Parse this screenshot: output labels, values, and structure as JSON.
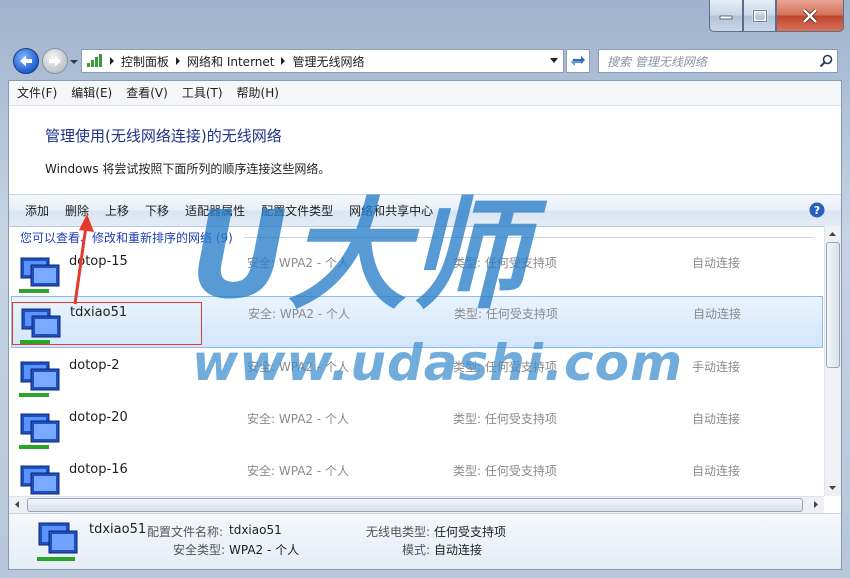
{
  "address": {
    "crumbs": [
      "控制面板",
      "网络和 Internet",
      "管理无线网络"
    ]
  },
  "search": {
    "placeholder": "搜索 管理无线网络"
  },
  "menu": [
    "文件(F)",
    "编辑(E)",
    "查看(V)",
    "工具(T)",
    "帮助(H)"
  ],
  "header": {
    "title": "管理使用(无线网络连接)的无线网络",
    "description": "Windows 将尝试按照下面所列的顺序连接这些网络。"
  },
  "commands": [
    "添加",
    "删除",
    "上移",
    "下移",
    "适配器属性",
    "配置文件类型",
    "网络和共享中心"
  ],
  "list": {
    "heading": "您可以查看、修改和重新排序的网络 (9)",
    "rows": [
      {
        "name": "dotop-15",
        "security": "安全: WPA2 - 个人",
        "type": "类型: 任何受支持项",
        "mode": "自动连接",
        "selected": false
      },
      {
        "name": "tdxiao51",
        "security": "安全: WPA2 - 个人",
        "type": "类型: 任何受支持项",
        "mode": "自动连接",
        "selected": true
      },
      {
        "name": "dotop-2",
        "security": "安全: WPA2 - 个人",
        "type": "类型: 任何受支持项",
        "mode": "手动连接",
        "selected": false
      },
      {
        "name": "dotop-20",
        "security": "安全: WPA2 - 个人",
        "type": "类型: 任何受支持项",
        "mode": "自动连接",
        "selected": false
      },
      {
        "name": "dotop-16",
        "security": "安全: WPA2 - 个人",
        "type": "类型: 任何受支持项",
        "mode": "自动连接",
        "selected": false
      }
    ]
  },
  "details": {
    "name": "tdxiao51",
    "profile_label": "配置文件名称:",
    "profile_value": "tdxiao51",
    "security_label": "安全类型:",
    "security_value": "WPA2 - 个人",
    "radio_label": "无线电类型:",
    "radio_value": "任何受支持项",
    "mode_label": "模式:",
    "mode_value": "自动连接"
  },
  "watermark": {
    "logo": "U大师",
    "url": "www.udashi.com"
  },
  "colors": {
    "accent": "#1e3fb5",
    "selection": "#d3e6fb",
    "annotation": "#e23a2d"
  }
}
